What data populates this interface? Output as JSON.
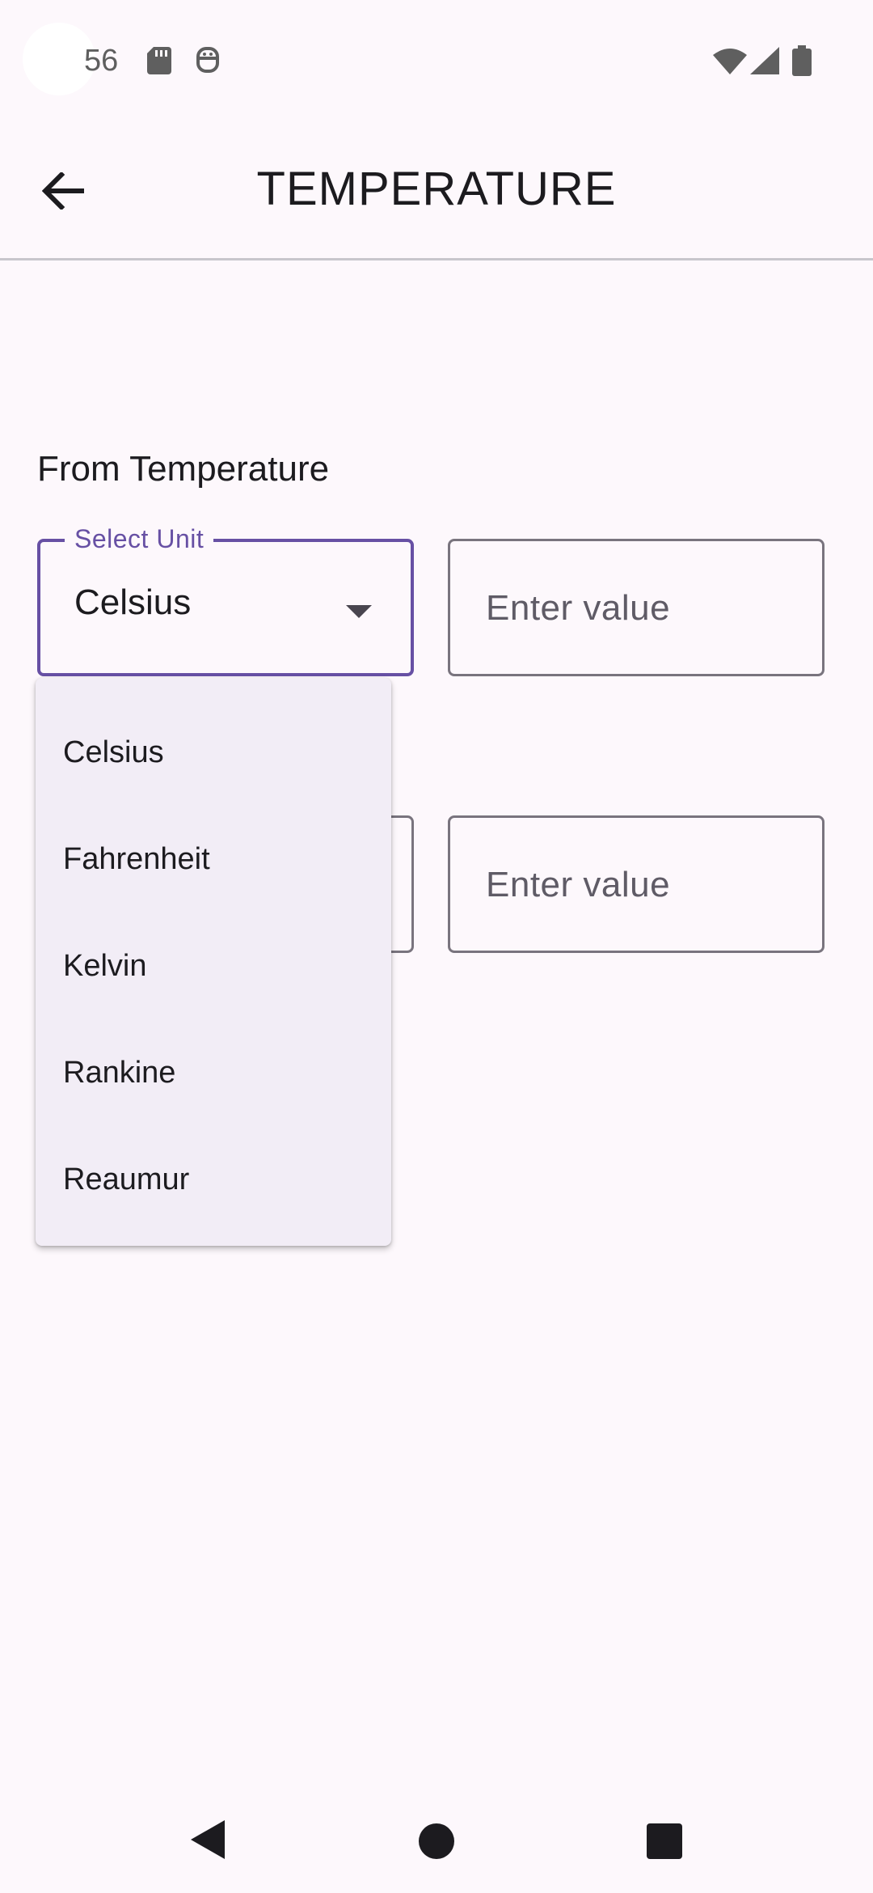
{
  "status_bar": {
    "time": "56",
    "icons": [
      "sd-card-icon",
      "robot-icon",
      "wifi-icon",
      "signal-icon",
      "battery-icon"
    ]
  },
  "app_bar": {
    "title": "TEMPERATURE",
    "back_icon": "arrow-left-icon"
  },
  "from_section": {
    "label": "From Temperature",
    "unit_select": {
      "label": "Select Unit",
      "value": "Celsius"
    },
    "value_input": {
      "placeholder": "Enter value",
      "value": ""
    }
  },
  "to_section": {
    "value_input": {
      "placeholder": "Enter value",
      "value": ""
    }
  },
  "dropdown": {
    "options": [
      {
        "label": "Celsius"
      },
      {
        "label": "Fahrenheit"
      },
      {
        "label": "Kelvin"
      },
      {
        "label": "Rankine"
      },
      {
        "label": "Reaumur"
      }
    ]
  },
  "nav_bar": {
    "icons": [
      "nav-back-icon",
      "nav-home-icon",
      "nav-recents-icon"
    ]
  },
  "colors": {
    "accent": "#6750a4",
    "background": "#fdf8fc",
    "menu_background": "#f2edf6",
    "outline": "#79747e"
  }
}
